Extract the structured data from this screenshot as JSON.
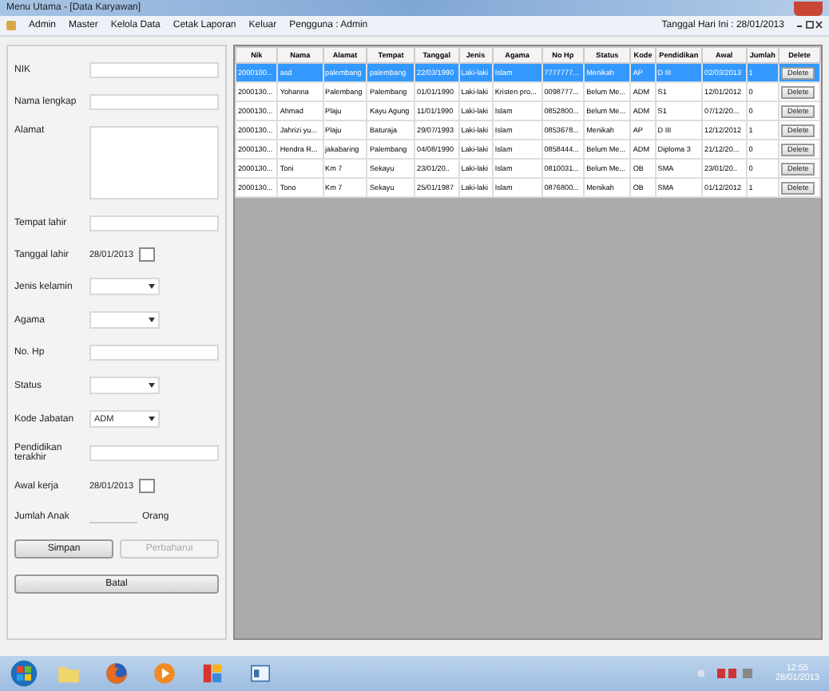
{
  "window": {
    "title": "Menu Utama - [Data Karyawan]"
  },
  "menu": {
    "items": [
      "Admin",
      "Master",
      "Kelola Data",
      "Cetak Laporan",
      "Keluar",
      "Pengguna : Admin"
    ],
    "date_label": "Tanggal Hari Ini : 28/01/2013"
  },
  "form": {
    "fields": [
      {
        "kind": "text",
        "label": "NIK"
      },
      {
        "kind": "text",
        "label": "Nama lengkap"
      },
      {
        "kind": "textarea",
        "label": "Alamat"
      },
      {
        "kind": "text",
        "label": "Tempat lahir"
      },
      {
        "kind": "date",
        "label": "Tanggal lahir",
        "value": "28/01/2013"
      },
      {
        "kind": "combo",
        "label": "Jenis kelamin"
      },
      {
        "kind": "combo",
        "label": "Agama"
      },
      {
        "kind": "text",
        "label": "No. Hp"
      },
      {
        "kind": "combo",
        "label": "Status"
      },
      {
        "kind": "combo",
        "label": "Kode Jabatan",
        "value": "ADM"
      },
      {
        "kind": "text",
        "label": "Pendidikan terakhir"
      },
      {
        "kind": "date",
        "label": "Awal kerja",
        "value": "28/01/2013"
      },
      {
        "kind": "number",
        "label": "Jumlah Anak",
        "suffix": "Orang"
      }
    ],
    "buttons": [
      {
        "label": "Simpan",
        "disabled": false
      },
      {
        "label": "Perbaharui",
        "disabled": true
      },
      {
        "label": "Batal",
        "disabled": false
      }
    ]
  },
  "table": {
    "columns": [
      "Nik",
      "Nama",
      "Alamat",
      "Tempat",
      "Tanggal",
      "Jenis",
      "Agama",
      "No Hp",
      "Status",
      "Kode",
      "Pendidikan",
      "Awal",
      "Jumlah",
      "Delete"
    ],
    "rows": [
      {
        "selected": true,
        "cells": [
          "2000100...",
          "asd",
          "palembang",
          "palembang",
          "22/03/1990",
          "Laki-laki",
          "Islam",
          "7777777...",
          "Menikah",
          "AP",
          "D III",
          "02/03/2013",
          "1",
          "Delete"
        ]
      },
      {
        "selected": false,
        "cells": [
          "2000130...",
          "Yohanna",
          "Palembang",
          "Palembang",
          "01/01/1990",
          "Laki-laki",
          "Kristen pro...",
          "0098777...",
          "Belum Me...",
          "ADM",
          "S1",
          "12/01/2012",
          "0",
          "Delete"
        ]
      },
      {
        "selected": false,
        "cells": [
          "2000130...",
          "Ahmad",
          "Plaju",
          "Kayu Agung",
          "11/01/1990",
          "Laki-laki",
          "Islam",
          "0852800...",
          "Belum Me...",
          "ADM",
          "S1",
          "07/12/20...",
          "0",
          "Delete"
        ]
      },
      {
        "selected": false,
        "cells": [
          "2000130...",
          "Jahrizi yu...",
          "Plaju",
          "Baturaja",
          "29/07/1993",
          "Laki-laki",
          "Islam",
          "0853678...",
          "Menikah",
          "AP",
          "D III",
          "12/12/2012",
          "1",
          "Delete"
        ]
      },
      {
        "selected": false,
        "cells": [
          "2000130...",
          "Hendra R...",
          "jakabaring",
          "Palembang",
          "04/08/1990",
          "Laki-laki",
          "Islam",
          "0858444...",
          "Belum Me...",
          "ADM",
          "Diploma 3",
          "21/12/20...",
          "0",
          "Delete"
        ]
      },
      {
        "selected": false,
        "cells": [
          "2000130...",
          "Toni",
          "Km 7",
          "Sekayu",
          "23/01/20..",
          "Laki-laki",
          "Islam",
          "0810031...",
          "Belum Me...",
          "OB",
          "SMA",
          "23/01/20..",
          "0",
          "Delete"
        ]
      },
      {
        "selected": false,
        "cells": [
          "2000130...",
          "Tono",
          "Km 7",
          "Sekayu",
          "25/01/1987",
          "Laki-laki",
          "Islam",
          "0876800...",
          "Menikah",
          "OB",
          "SMA",
          "01/12/2012",
          "1",
          "Delete"
        ]
      }
    ]
  },
  "taskbar": {
    "time": "12:55",
    "date": "28/01/2013"
  }
}
